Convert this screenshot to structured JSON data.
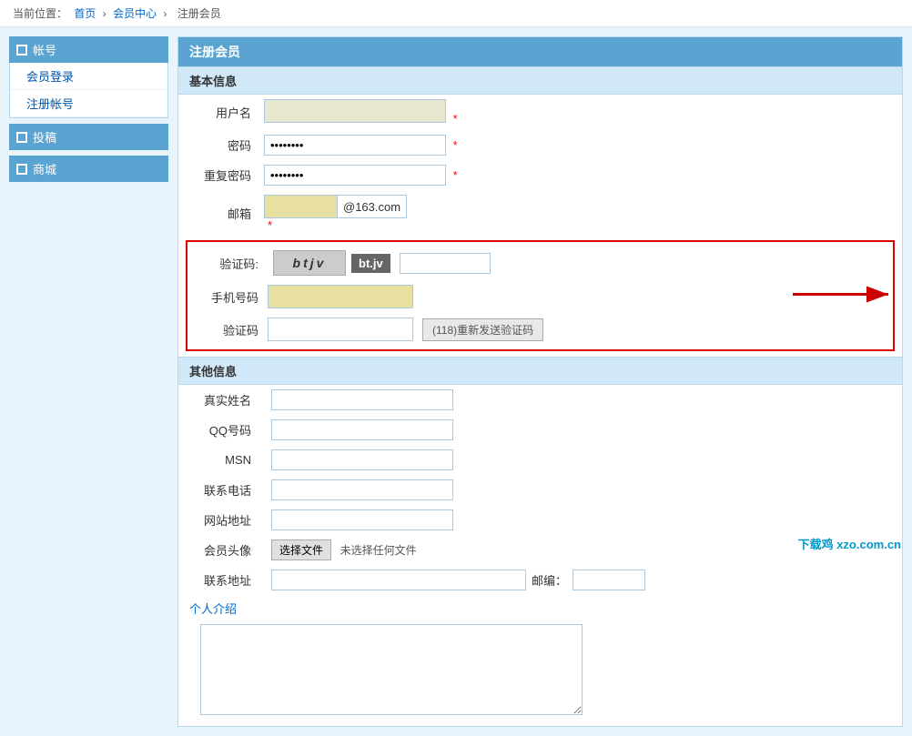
{
  "breadcrumb": {
    "current": "当前位置：",
    "home": "首页",
    "sep1": "›",
    "member_center": "会员中心",
    "sep2": "›",
    "register": "注册会员"
  },
  "sidebar": {
    "sections": [
      {
        "id": "account",
        "title": "帐号",
        "links": [
          {
            "label": "会员登录",
            "href": "#"
          },
          {
            "label": "注册帐号",
            "href": "#"
          }
        ]
      },
      {
        "id": "submit",
        "title": "投稿",
        "links": []
      },
      {
        "id": "shop",
        "title": "商城",
        "links": []
      }
    ]
  },
  "form": {
    "title": "注册会员",
    "basic_info_title": "基本信息",
    "fields": {
      "username_label": "用户名",
      "password_label": "密码",
      "password_placeholder": "••••••••",
      "confirm_password_label": "重复密码",
      "confirm_password_placeholder": "••••••••",
      "email_label": "邮箱",
      "email_suffix": "@163.com"
    },
    "verify_section": {
      "captcha_label": "验证码:",
      "captcha_value": "btjv",
      "captcha_display": "bt.jv",
      "phone_label": "手机号码",
      "sms_label": "验证码",
      "resend_btn": "(118)重新发送验证码"
    },
    "other_info_title": "其他信息",
    "other_fields": {
      "real_name_label": "真实姓名",
      "qq_label": "QQ号码",
      "msn_label": "MSN",
      "phone_label": "联系电话",
      "website_label": "网站地址",
      "avatar_label": "会员头像",
      "choose_file_btn": "选择文件",
      "no_file_text": "未选择任何文件",
      "address_label": "联系地址",
      "zip_label": "邮编：",
      "bio_label": "个人介绍"
    }
  },
  "watermark": "下载鸡 xzo.com.cn"
}
